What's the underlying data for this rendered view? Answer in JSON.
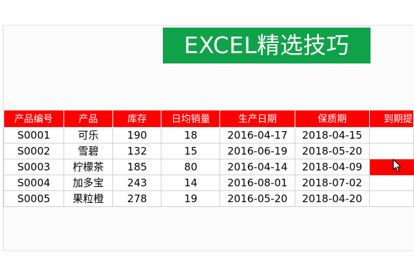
{
  "banner": {
    "title": "EXCEL精选技巧"
  },
  "table": {
    "headers": [
      "产品编号",
      "产品",
      "库存",
      "日均销量",
      "生产日期",
      "保质期",
      "到期提"
    ],
    "rows": [
      [
        "S0001",
        "可乐",
        "190",
        "18",
        "2016-04-17",
        "2018-04-15",
        ""
      ],
      [
        "S0002",
        "雪碧",
        "132",
        "15",
        "2016-06-19",
        "2018-05-20",
        ""
      ],
      [
        "S0003",
        "柠檬茶",
        "185",
        "80",
        "2016-04-14",
        "2018-04-09",
        ""
      ],
      [
        "S0004",
        "加多宝",
        "243",
        "14",
        "2016-08-01",
        "2018-07-02",
        ""
      ],
      [
        "S0005",
        "果粒橙",
        "278",
        "19",
        "2016-05-20",
        "2018-04-20",
        ""
      ]
    ]
  },
  "colors": {
    "banner_bg": "#10a24a",
    "header_bg": "#ff0000",
    "flag_cell": "#ff0000"
  },
  "icons": {
    "pointer": "mouse-pointer-icon"
  }
}
